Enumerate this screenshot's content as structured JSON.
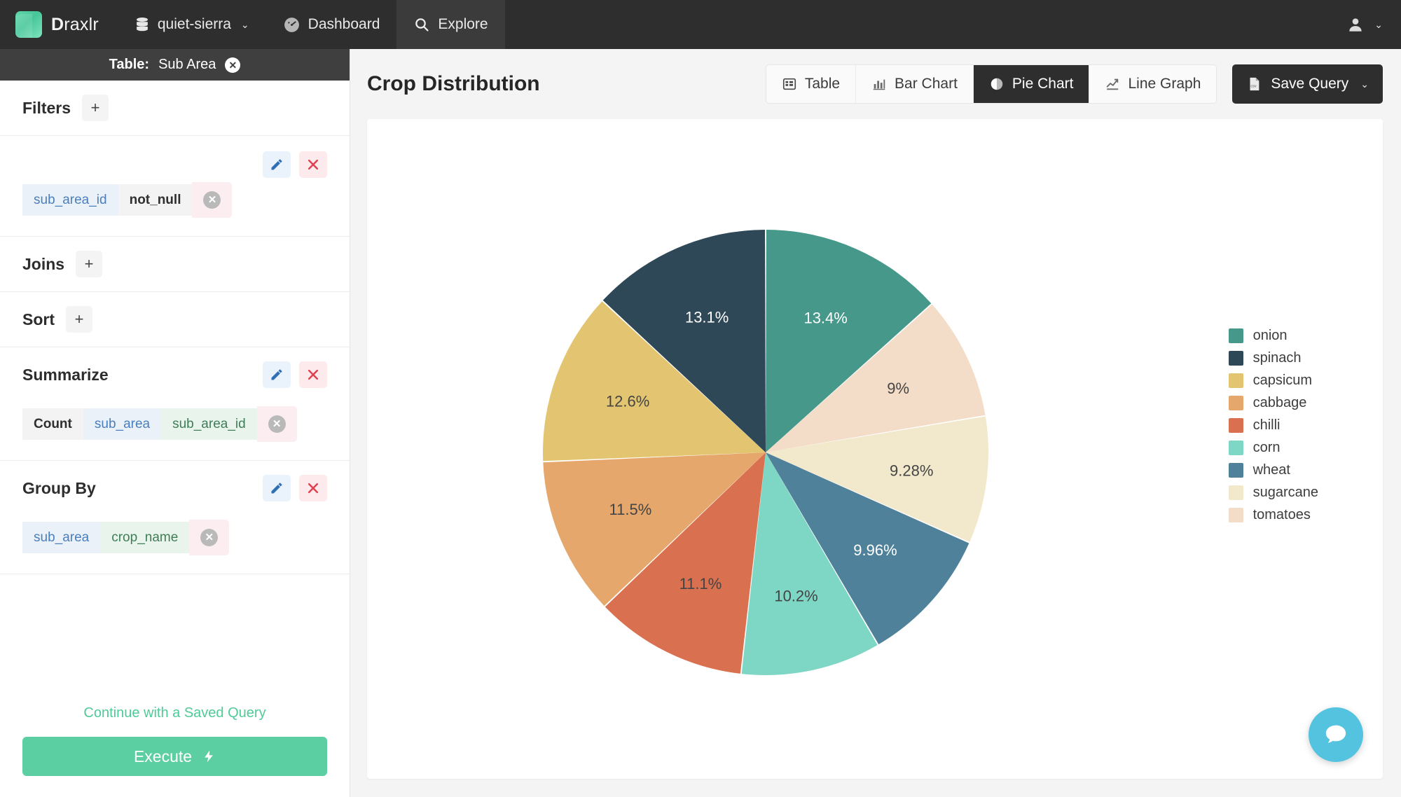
{
  "navbar": {
    "brand_bold": "D",
    "brand_rest": "raxlr",
    "database": "quiet-sierra",
    "database_caret": "⌄",
    "dashboard": "Dashboard",
    "explore": "Explore",
    "user_caret": "⌄",
    "icons": {
      "database": "database-icon",
      "dashboard": "speedometer-icon",
      "explore": "search-icon",
      "user": "user-icon"
    }
  },
  "sidebar": {
    "table_label": "Table:",
    "table_name": "Sub Area",
    "close_glyph": "✕",
    "sections": {
      "filters": {
        "title": "Filters",
        "add_glyph": "+",
        "chip": {
          "field": "sub_area_id",
          "operator": "not_null",
          "remove_glyph": "✕"
        }
      },
      "joins": {
        "title": "Joins",
        "add_glyph": "+"
      },
      "sort": {
        "title": "Sort",
        "add_glyph": "+"
      },
      "summarize": {
        "title": "Summarize",
        "chip": {
          "func": "Count",
          "table": "sub_area",
          "column": "sub_area_id",
          "remove_glyph": "✕"
        }
      },
      "group_by": {
        "title": "Group By",
        "chip": {
          "table": "sub_area",
          "column": "crop_name",
          "remove_glyph": "✕"
        }
      }
    },
    "saved_query_link": "Continue with a Saved Query",
    "execute_label": "Execute",
    "execute_glyph": "⚡"
  },
  "main": {
    "title": "Crop Distribution",
    "view_tabs": [
      {
        "label": "Table",
        "icon": "table-icon",
        "active": false
      },
      {
        "label": "Bar Chart",
        "icon": "bar-chart-icon",
        "active": false
      },
      {
        "label": "Pie Chart",
        "icon": "pie-chart-icon",
        "active": true
      },
      {
        "label": "Line Graph",
        "icon": "line-graph-icon",
        "active": false
      }
    ],
    "save_query": {
      "label": "Save Query",
      "icon": "csv-file-icon",
      "caret": "⌄"
    },
    "chat_icon": "chat-bubble-icon"
  },
  "colors": {
    "accent_green": "#5ccfa2",
    "navbar_bg": "#2e2e2e",
    "table_bar_bg": "#3f3f3f",
    "chat_bubble": "#53c3e0"
  },
  "chart_data": {
    "type": "pie",
    "title": "Crop Distribution",
    "legend_position": "right",
    "start_angle_deg": 0,
    "direction": "clockwise",
    "labels_on_slices": true,
    "categories": [
      "onion",
      "spinach",
      "capsicum",
      "cabbage",
      "chilli",
      "corn",
      "wheat",
      "sugarcane",
      "tomatoes"
    ],
    "colors": [
      "#46988a",
      "#2f4858",
      "#e3c571",
      "#e6a76c",
      "#d9704f",
      "#7ed6c4",
      "#4f829a",
      "#f2e8cc",
      "#f3ddc8"
    ],
    "slice_order_clockwise": [
      "onion",
      "tomatoes",
      "sugarcane",
      "wheat",
      "corn",
      "chilli",
      "cabbage",
      "capsicum",
      "spinach"
    ],
    "values": [
      13.4,
      13.1,
      12.6,
      11.5,
      11.1,
      10.2,
      9.96,
      9.28,
      9.0
    ],
    "value_labels": [
      "13.4%",
      "13.1%",
      "12.6%",
      "11.5%",
      "11.1%",
      "10.2%",
      "9.96%",
      "9.28%",
      "9%"
    ],
    "slices": [
      {
        "name": "onion",
        "percent": 13.4,
        "label": "13.4%",
        "color": "#46988a",
        "label_color": "#ffffff"
      },
      {
        "name": "tomatoes",
        "percent": 9.0,
        "label": "9%",
        "color": "#f3ddc8",
        "label_color": "#444444"
      },
      {
        "name": "sugarcane",
        "percent": 9.28,
        "label": "9.28%",
        "color": "#f2e8cc",
        "label_color": "#444444"
      },
      {
        "name": "wheat",
        "percent": 9.96,
        "label": "9.96%",
        "color": "#4f829a",
        "label_color": "#ffffff"
      },
      {
        "name": "corn",
        "percent": 10.2,
        "label": "10.2%",
        "color": "#7ed6c4",
        "label_color": "#444444"
      },
      {
        "name": "chilli",
        "percent": 11.1,
        "label": "11.1%",
        "color": "#d9704f",
        "label_color": "#444444"
      },
      {
        "name": "cabbage",
        "percent": 11.5,
        "label": "11.5%",
        "color": "#e6a76c",
        "label_color": "#444444"
      },
      {
        "name": "capsicum",
        "percent": 12.6,
        "label": "12.6%",
        "color": "#e3c571",
        "label_color": "#444444"
      },
      {
        "name": "spinach",
        "percent": 13.1,
        "label": "13.1%",
        "color": "#2f4858",
        "label_color": "#ffffff"
      }
    ],
    "legend": [
      {
        "label": "onion",
        "color": "#46988a"
      },
      {
        "label": "spinach",
        "color": "#2f4858"
      },
      {
        "label": "capsicum",
        "color": "#e3c571"
      },
      {
        "label": "cabbage",
        "color": "#e6a76c"
      },
      {
        "label": "chilli",
        "color": "#d9704f"
      },
      {
        "label": "corn",
        "color": "#7ed6c4"
      },
      {
        "label": "wheat",
        "color": "#4f829a"
      },
      {
        "label": "sugarcane",
        "color": "#f2e8cc"
      },
      {
        "label": "tomatoes",
        "color": "#f3ddc8"
      }
    ]
  }
}
